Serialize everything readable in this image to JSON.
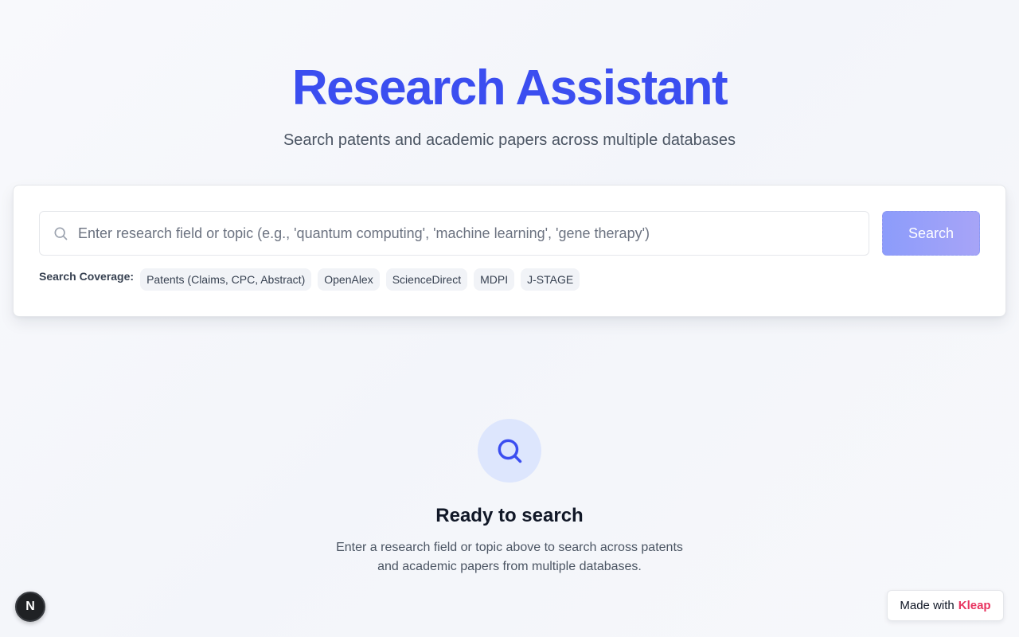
{
  "header": {
    "title": "Research Assistant",
    "subtitle": "Search patents and academic papers across multiple databases"
  },
  "search": {
    "placeholder": "Enter research field or topic (e.g., 'quantum computing', 'machine learning', 'gene therapy')",
    "value": "",
    "button_label": "Search",
    "icon": "search-icon"
  },
  "coverage": {
    "label": "Search Coverage:",
    "chips": [
      "Patents (Claims, CPC, Abstract)",
      "OpenAlex",
      "ScienceDirect",
      "MDPI",
      "J-STAGE"
    ]
  },
  "empty_state": {
    "icon": "search-icon",
    "title": "Ready to search",
    "description": "Enter a research field or topic above to search across patents and academic papers from multiple databases."
  },
  "badge": {
    "letter": "N"
  },
  "made_with": {
    "prefix": "Made with",
    "brand": "Kleap"
  },
  "colors": {
    "accent": "#3b4ef0",
    "brand": "#e8335f",
    "button": "#9aa0f9",
    "icon_circle": "#dde6fd"
  }
}
